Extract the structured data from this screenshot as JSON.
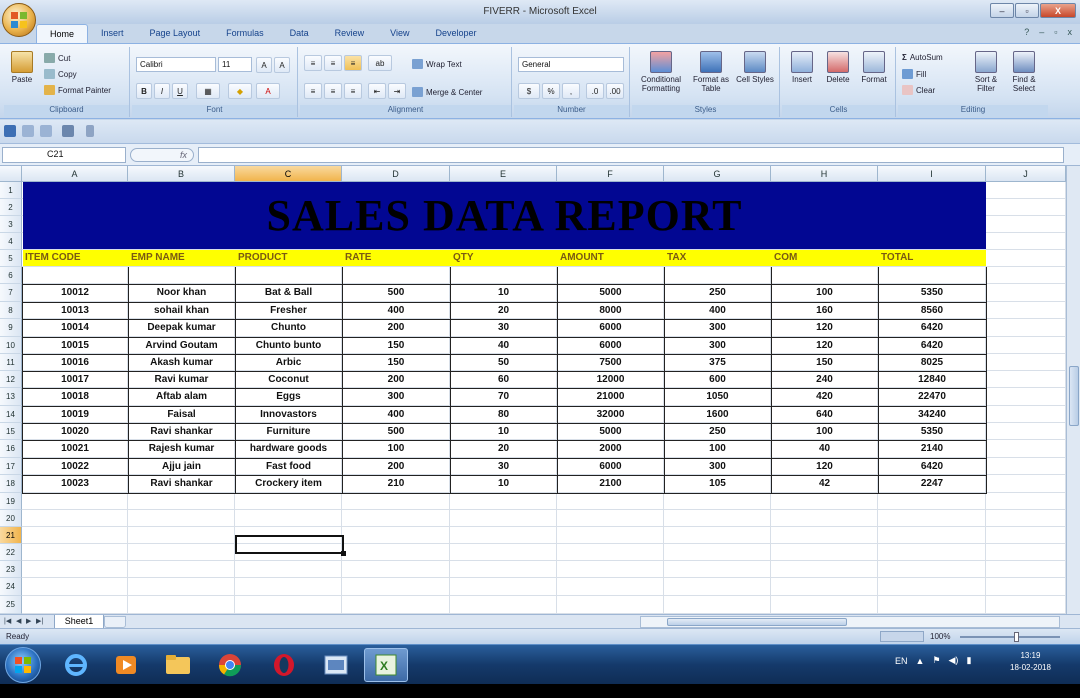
{
  "window": {
    "title": "FIVERR - Microsoft Excel",
    "controls": [
      "–",
      "▫",
      "X"
    ]
  },
  "ribbon_tabs": [
    "Home",
    "Insert",
    "Page Layout",
    "Formulas",
    "Data",
    "Review",
    "View",
    "Developer"
  ],
  "ribbon": {
    "clipboard": {
      "paste": "Paste",
      "cut": "Cut",
      "copy": "Copy",
      "format_painter": "Format Painter",
      "label": "Clipboard"
    },
    "font": {
      "name": "Calibri",
      "size": "11",
      "bold": "B",
      "italic": "I",
      "underline": "U",
      "label": "Font"
    },
    "alignment": {
      "wrap": "Wrap Text",
      "merge": "Merge & Center",
      "label": "Alignment"
    },
    "number": {
      "format": "General",
      "label": "Number"
    },
    "styles": {
      "conditional": "Conditional Formatting",
      "format_table": "Format as Table",
      "cell_styles": "Cell Styles",
      "label": "Styles"
    },
    "cells": {
      "insert": "Insert",
      "delete": "Delete",
      "format": "Format",
      "label": "Cells"
    },
    "editing": {
      "autosum": "AutoSum",
      "fill": "Fill",
      "clear": "Clear",
      "sort": "Sort & Filter",
      "find": "Find & Select",
      "label": "Editing"
    }
  },
  "formula_bar": {
    "name_box": "C21",
    "fx": "fx",
    "value": ""
  },
  "columns": [
    "A",
    "B",
    "C",
    "D",
    "E",
    "F",
    "G",
    "H",
    "I",
    "J"
  ],
  "selected_column": "C",
  "rows": [
    "1",
    "2",
    "3",
    "4",
    "5",
    "6",
    "7",
    "8",
    "9",
    "10",
    "11",
    "12",
    "13",
    "14",
    "15",
    "16",
    "17",
    "18",
    "19",
    "20",
    "21",
    "22",
    "23",
    "24",
    "25"
  ],
  "selected_row": "21",
  "report": {
    "title": "SALES DATA REPORT",
    "headers": [
      "ITEM CODE",
      "EMP NAME",
      "PRODUCT",
      "RATE",
      "QTY",
      "AMOUNT",
      "TAX",
      "COM",
      "TOTAL"
    ],
    "records": [
      [
        "10012",
        "Noor khan",
        "Bat & Ball",
        "500",
        "10",
        "5000",
        "250",
        "100",
        "5350"
      ],
      [
        "10013",
        "sohail khan",
        "Fresher",
        "400",
        "20",
        "8000",
        "400",
        "160",
        "8560"
      ],
      [
        "10014",
        "Deepak kumar",
        "Chunto",
        "200",
        "30",
        "6000",
        "300",
        "120",
        "6420"
      ],
      [
        "10015",
        "Arvind Goutam",
        "Chunto bunto",
        "150",
        "40",
        "6000",
        "300",
        "120",
        "6420"
      ],
      [
        "10016",
        "Akash kumar",
        "Arbic",
        "150",
        "50",
        "7500",
        "375",
        "150",
        "8025"
      ],
      [
        "10017",
        "Ravi kumar",
        "Coconut",
        "200",
        "60",
        "12000",
        "600",
        "240",
        "12840"
      ],
      [
        "10018",
        "Aftab alam",
        "Eggs",
        "300",
        "70",
        "21000",
        "1050",
        "420",
        "22470"
      ],
      [
        "10019",
        "Faisal",
        "Innovastors",
        "400",
        "80",
        "32000",
        "1600",
        "640",
        "34240"
      ],
      [
        "10020",
        "Ravi shankar",
        "Furniture",
        "500",
        "10",
        "5000",
        "250",
        "100",
        "5350"
      ],
      [
        "10021",
        "Rajesh kumar",
        "hardware goods",
        "100",
        "20",
        "2000",
        "100",
        "40",
        "2140"
      ],
      [
        "10022",
        "Ajju jain",
        "Fast food",
        "200",
        "30",
        "6000",
        "300",
        "120",
        "6420"
      ],
      [
        "10023",
        "Ravi shankar",
        "Crockery item",
        "210",
        "10",
        "2100",
        "105",
        "42",
        "2247"
      ]
    ]
  },
  "sheet_tabs": [
    "Sheet1"
  ],
  "status": {
    "ready": "Ready",
    "zoom": "100%"
  },
  "taskbar": {
    "lang": "EN",
    "time": "13:19",
    "date": "18-02-2018"
  },
  "colors": {
    "banner": "#020792",
    "header_fill": "#ffff00",
    "header_text": "#7a5a12"
  }
}
